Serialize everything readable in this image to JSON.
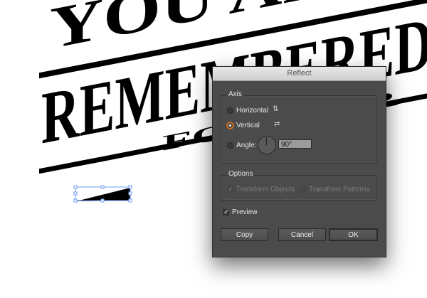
{
  "artwork": {
    "line1": "YOU ARE",
    "line2": "REMEMBERED",
    "line3": "FOREVER"
  },
  "dialog": {
    "title": "Reflect",
    "axis": {
      "legend": "Axis",
      "horizontal_label": "Horizontal",
      "vertical_label": "Vertical",
      "angle_label": "Angle:",
      "angle_value": "90°",
      "selected": "Vertical"
    },
    "options": {
      "legend": "Options",
      "transform_objects_label": "Transform Objects",
      "transform_objects_checked": true,
      "transform_patterns_label": "Transform Patterns",
      "transform_patterns_checked": false
    },
    "preview_label": "Preview",
    "preview_checked": true,
    "buttons": {
      "copy": "Copy",
      "cancel": "Cancel",
      "ok": "OK"
    },
    "check_glyph": "✓"
  }
}
